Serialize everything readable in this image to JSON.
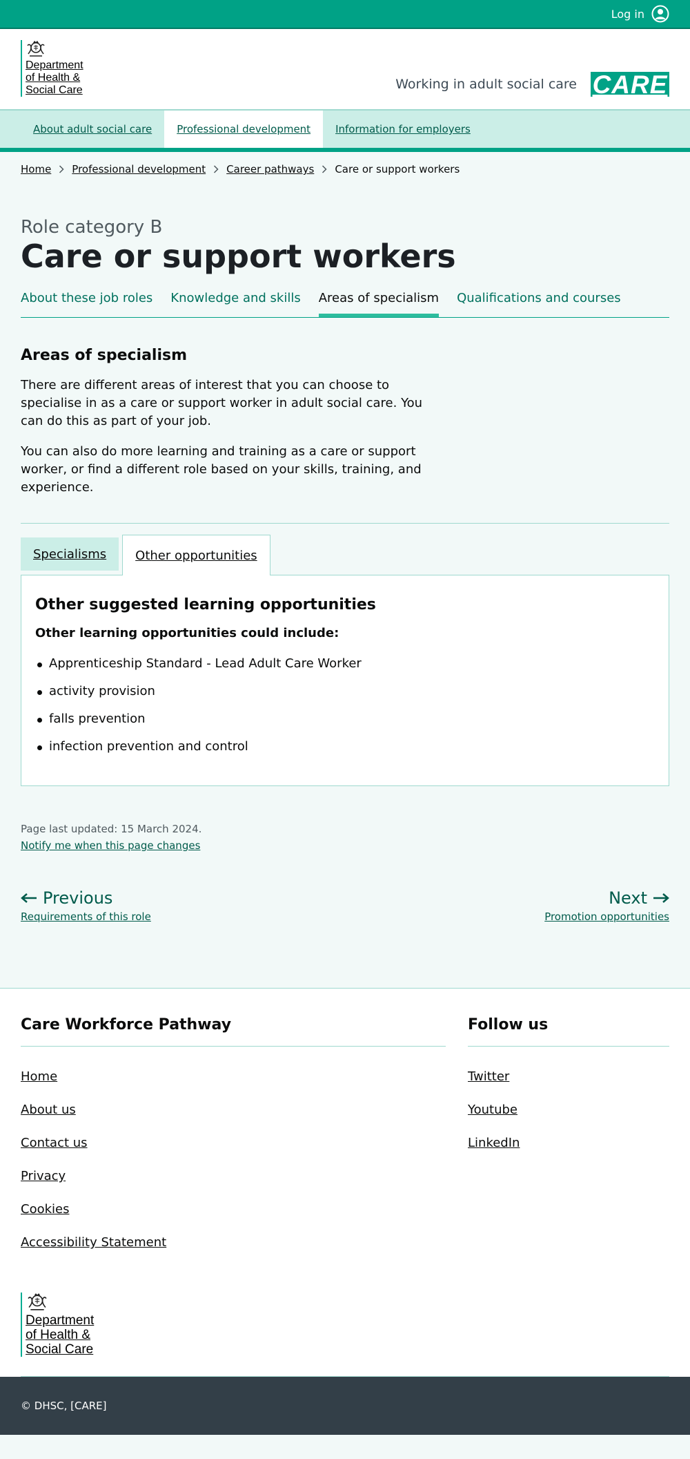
{
  "topbar": {
    "login_label": "Log in",
    "icon": "user-circle-icon"
  },
  "header": {
    "org_lines": [
      "Department",
      "of Health &",
      "Social Care"
    ],
    "service_name": "Working in adult social care",
    "brand": "CARE",
    "brand_color": "#00a286"
  },
  "nav": {
    "items": [
      {
        "label": "About adult social care",
        "active": false
      },
      {
        "label": "Professional development",
        "active": true
      },
      {
        "label": "Information for employers",
        "active": false
      }
    ]
  },
  "breadcrumbs": [
    "Home",
    "Professional development",
    "Career pathways",
    "Care or support workers"
  ],
  "page": {
    "caption": "Role category B",
    "title": "Care or support workers",
    "subnav": [
      {
        "label": "About these job roles",
        "active": false
      },
      {
        "label": "Knowledge and skills",
        "active": false
      },
      {
        "label": "Areas of specialism",
        "active": true
      },
      {
        "label": "Qualifications and courses",
        "active": false
      }
    ],
    "section_heading": "Areas of specialism",
    "paragraphs": [
      "There are different areas of interest that you can choose to specialise in as a care or support worker in adult social care. You can do this as part of your job.",
      "You can also do more learning and training as a care or support worker, or find a different role based on your skills, training, and experience."
    ]
  },
  "tabs": {
    "items": [
      {
        "label": "Specialisms",
        "selected": false
      },
      {
        "label": "Other opportunities",
        "selected": true
      }
    ],
    "panel": {
      "heading": "Other suggested learning opportunities",
      "subheading": "Other learning opportunities could include:",
      "list": [
        "Apprenticeship Standard - Lead Adult Care Worker",
        "activity provision",
        "falls prevention",
        "infection prevention and control"
      ]
    }
  },
  "meta": {
    "last_updated": "Page last updated: 15 March 2024.",
    "notify_link": "Notify me when this page changes"
  },
  "pagination": {
    "previous_label": "Previous",
    "previous_title": "Requirements of this role",
    "next_label": "Next",
    "next_title": "Promotion opportunities"
  },
  "footer": {
    "main_heading": "Care Workforce Pathway",
    "main_links": [
      "Home",
      "About us",
      "Contact us",
      "Privacy",
      "Cookies",
      "Accessibility Statement"
    ],
    "follow_heading": "Follow us",
    "follow_links": [
      "Twitter",
      "Youtube",
      "LinkedIn"
    ],
    "org_lines": [
      "Department",
      "of Health &",
      "Social Care"
    ],
    "copyright": "© DHSC, [CARE]"
  },
  "colors": {
    "primary": "#00a286",
    "nav_bg": "#cbeee7",
    "page_bg": "#f2f9f8",
    "footer_dark": "#333f48",
    "link_green": "#005b4b"
  }
}
